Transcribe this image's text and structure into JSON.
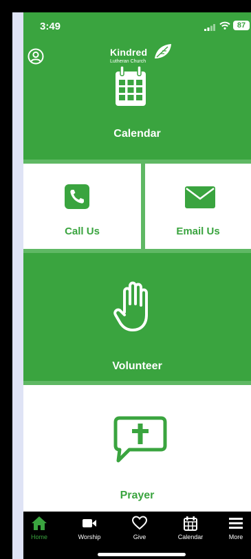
{
  "status_bar": {
    "time": "3:49",
    "battery": "87"
  },
  "header": {
    "logo_name": "Kindred",
    "logo_sub": "Lutheran Church"
  },
  "tiles": {
    "calendar": "Calendar",
    "call": "Call Us",
    "email": "Email Us",
    "volunteer": "Volunteer",
    "prayer": "Prayer"
  },
  "tab_bar": {
    "items": [
      {
        "label": "Home",
        "icon": "home-icon",
        "active": true
      },
      {
        "label": "Worship",
        "icon": "video-camera-icon",
        "active": false
      },
      {
        "label": "Give",
        "icon": "heart-icon",
        "active": false
      },
      {
        "label": "Calendar",
        "icon": "calendar-icon",
        "active": false
      },
      {
        "label": "More",
        "icon": "menu-icon",
        "active": false
      }
    ]
  },
  "colors": {
    "brand_green": "#3aa43f",
    "divider_green": "#5fb864",
    "tab_bar": "#000000",
    "active_tab": "#3aa43f"
  }
}
